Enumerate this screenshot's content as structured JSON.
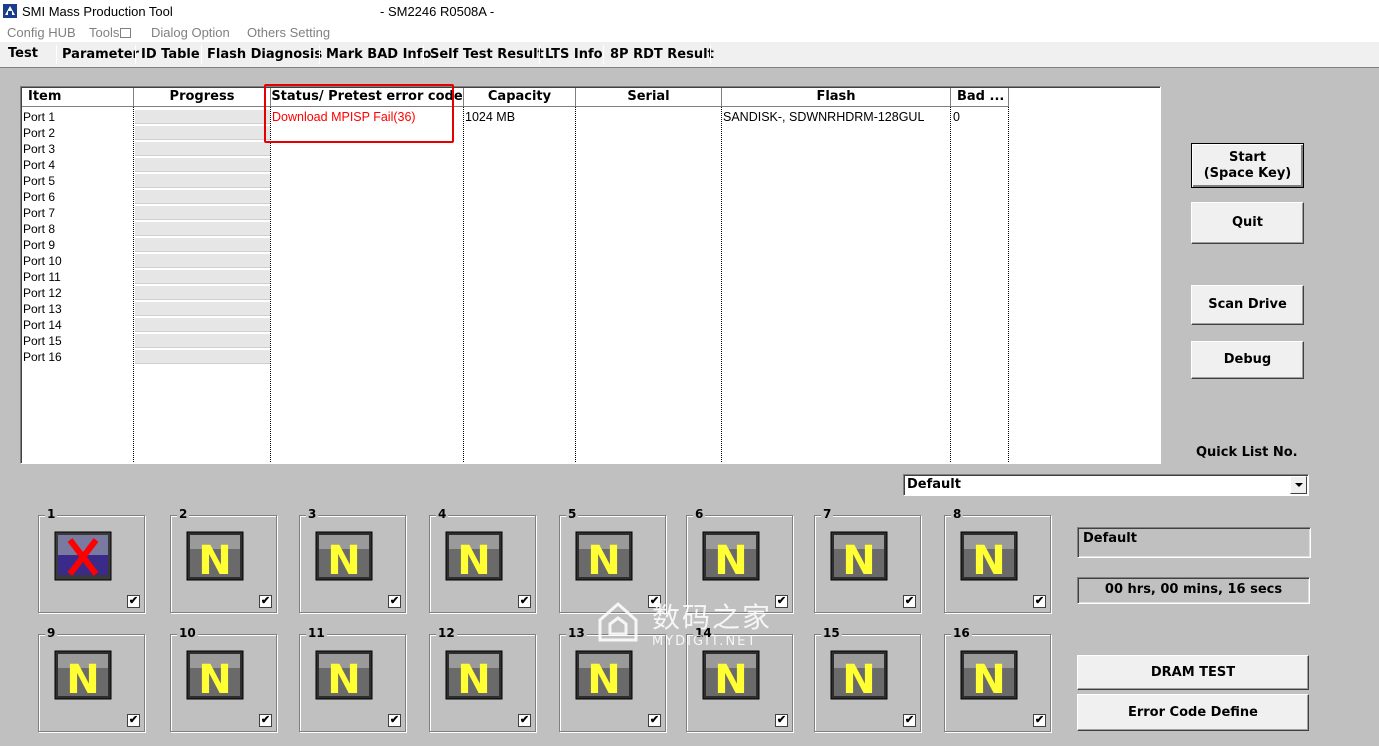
{
  "window": {
    "title": "SMI Mass Production Tool",
    "firmware": "- SM2246 R0508A -"
  },
  "menu": [
    "Config HUB",
    "Tools",
    "Dialog Option",
    "Others Setting"
  ],
  "tabs": [
    "Test",
    "Parameter",
    "ID Table",
    "Flash Diagnosis",
    "Mark BAD Info",
    "Self Test Result",
    "LTS Info",
    "8P RDT Result"
  ],
  "table": {
    "columns": [
      "Item",
      "Progress",
      "Status/ Pretest error code",
      "Capacity",
      "Serial",
      "Flash",
      "Bad ..."
    ],
    "ports": [
      "Port 1",
      "Port 2",
      "Port 3",
      "Port 4",
      "Port 5",
      "Port 6",
      "Port 7",
      "Port 8",
      "Port 9",
      "Port 10",
      "Port 11",
      "Port 12",
      "Port 13",
      "Port 14",
      "Port 15",
      "Port 16"
    ],
    "row1": {
      "status": "Download MPISP Fail(36)",
      "capacity": "1024 MB",
      "serial": "",
      "flash": "SANDISK-, SDWNRHDRM-128GUL",
      "bad": "0"
    }
  },
  "buttons": {
    "start_line1": "Start",
    "start_line2": "(Space Key)",
    "quit": "Quit",
    "scan_drive": "Scan Drive",
    "debug": "Debug",
    "dram_test": "DRAM TEST",
    "error_code_define": "Error Code Define"
  },
  "quick_list": {
    "label": "Quick List No.",
    "selected": "Default"
  },
  "info_panel": {
    "profile": "Default",
    "elapsed": "00 hrs, 00 mins, 16 secs"
  },
  "port_panels": [
    {
      "num": "1",
      "state": "fail",
      "checked": true
    },
    {
      "num": "2",
      "state": "N",
      "checked": true
    },
    {
      "num": "3",
      "state": "N",
      "checked": true
    },
    {
      "num": "4",
      "state": "N",
      "checked": true
    },
    {
      "num": "5",
      "state": "N",
      "checked": true
    },
    {
      "num": "6",
      "state": "N",
      "checked": true
    },
    {
      "num": "7",
      "state": "N",
      "checked": true
    },
    {
      "num": "8",
      "state": "N",
      "checked": true
    },
    {
      "num": "9",
      "state": "N",
      "checked": true
    },
    {
      "num": "10",
      "state": "N",
      "checked": true
    },
    {
      "num": "11",
      "state": "N",
      "checked": true
    },
    {
      "num": "12",
      "state": "N",
      "checked": true
    },
    {
      "num": "13",
      "state": "N",
      "checked": true
    },
    {
      "num": "14",
      "state": "N",
      "checked": true
    },
    {
      "num": "15",
      "state": "N",
      "checked": true
    },
    {
      "num": "16",
      "state": "N",
      "checked": true
    }
  ],
  "watermark": {
    "text_cn": "数码之家",
    "text_en": "MYDIGIT.NET"
  },
  "colors": {
    "window_bg": "#c0c0c0",
    "error_text": "#ff0000",
    "highlight_box": "#e60000",
    "port_n_letter": "#ffff33",
    "port_fail_x": "#ff0000"
  }
}
